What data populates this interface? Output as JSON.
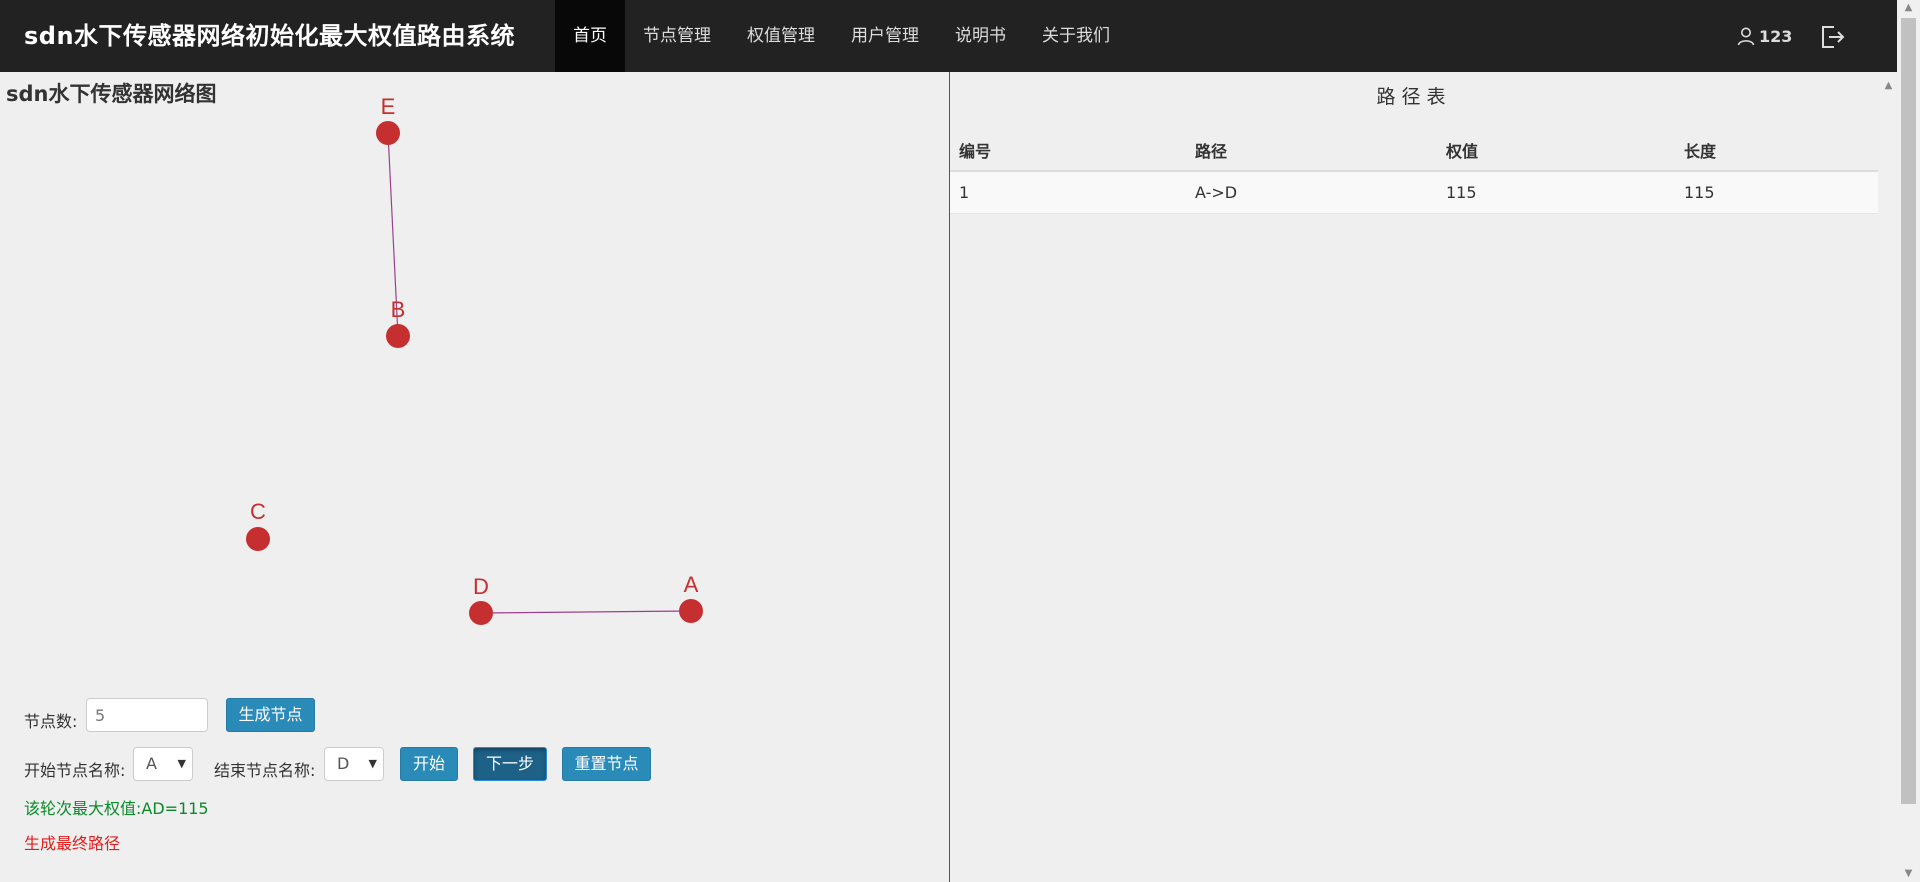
{
  "app": {
    "brand": "sdn水下传感器网络初始化最大权值路由系统"
  },
  "nav": {
    "items": [
      {
        "label": "首页"
      },
      {
        "label": "节点管理"
      },
      {
        "label": "权值管理"
      },
      {
        "label": "用户管理"
      },
      {
        "label": "说明书"
      },
      {
        "label": "关于我们"
      }
    ]
  },
  "user": {
    "name": "123",
    "icons": {
      "user": "user-icon",
      "logout": "logout-icon"
    }
  },
  "graph": {
    "title": "sdn水下传感器网络图",
    "node_color": "#c62f2f",
    "label_color": "#c62f2f",
    "nodes": [
      {
        "label": "E"
      },
      {
        "label": "B"
      },
      {
        "label": "C"
      },
      {
        "label": "D"
      },
      {
        "label": "A"
      }
    ],
    "edges": [
      {
        "from": "E",
        "to": "B"
      },
      {
        "from": "D",
        "to": "A"
      }
    ]
  },
  "controls": {
    "node_count_label": "节点数:",
    "node_count_value": "5",
    "generate_button": "生成节点",
    "start_node_label": "开始节点名称:",
    "start_node_value": "A",
    "end_node_label": "结束节点名称:",
    "end_node_value": "D",
    "start_button": "开始",
    "next_button": "下一步",
    "reset_button": "重置节点",
    "round_max_message": "该轮次最大权值:AD=115",
    "final_path_message": "生成最终路径",
    "accent_color": "#2a8ab8"
  },
  "path_table": {
    "caption": "路径表",
    "columns": [
      "编号",
      "路径",
      "权值",
      "长度"
    ],
    "rows": [
      [
        "1",
        "A->D",
        "115",
        "115"
      ]
    ]
  }
}
